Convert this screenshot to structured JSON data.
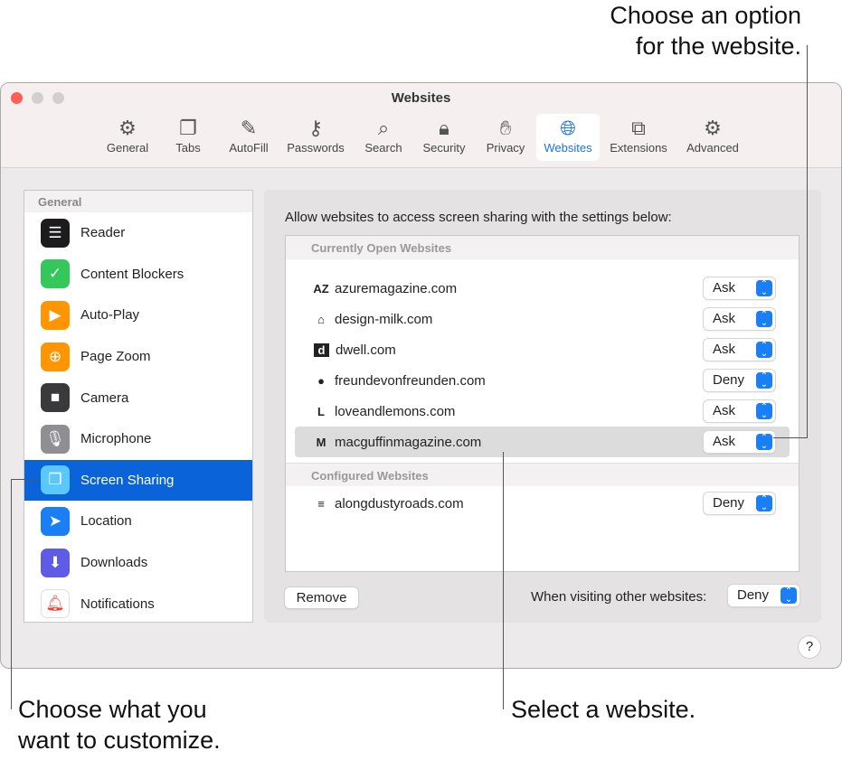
{
  "callouts": {
    "top_right": [
      "Choose an option",
      "for the website."
    ],
    "bottom_left": [
      "Choose what you",
      "want to customize."
    ],
    "bottom_mid": "Select a website."
  },
  "window": {
    "title": "Websites"
  },
  "toolbar": [
    {
      "label": "General",
      "icon": "gear-icon",
      "glyph": "⚙"
    },
    {
      "label": "Tabs",
      "icon": "tabs-icon",
      "glyph": "❐"
    },
    {
      "label": "AutoFill",
      "icon": "autofill-icon",
      "glyph": "✎"
    },
    {
      "label": "Passwords",
      "icon": "key-icon",
      "glyph": "⚷"
    },
    {
      "label": "Search",
      "icon": "search-icon",
      "glyph": "⌕"
    },
    {
      "label": "Security",
      "icon": "lock-icon",
      "glyph": "🔒︎"
    },
    {
      "label": "Privacy",
      "icon": "hand-icon",
      "glyph": "✋︎"
    },
    {
      "label": "Websites",
      "icon": "globe-icon",
      "glyph": "🌐︎",
      "active": true
    },
    {
      "label": "Extensions",
      "icon": "puzzle-icon",
      "glyph": "⧉"
    },
    {
      "label": "Advanced",
      "icon": "gears-icon",
      "glyph": "⚙"
    }
  ],
  "sidebar": {
    "header": "General",
    "items": [
      {
        "label": "Reader",
        "icon": "reader-icon",
        "glyph": "☰",
        "color": "#1c1c1e"
      },
      {
        "label": "Content Blockers",
        "icon": "shield-check-icon",
        "glyph": "✓",
        "color": "#34c759"
      },
      {
        "label": "Auto-Play",
        "icon": "play-icon",
        "glyph": "▶",
        "color": "#ff9500"
      },
      {
        "label": "Page Zoom",
        "icon": "zoom-icon",
        "glyph": "⊕",
        "color": "#ff9500"
      },
      {
        "label": "Camera",
        "icon": "camera-icon",
        "glyph": "■",
        "color": "#3a3a3c"
      },
      {
        "label": "Microphone",
        "icon": "microphone-icon",
        "glyph": "🎙︎",
        "color": "#8e8e93"
      },
      {
        "label": "Screen Sharing",
        "icon": "screen-sharing-icon",
        "glyph": "❐",
        "color": "#5ac8fa",
        "selected": true
      },
      {
        "label": "Location",
        "icon": "location-icon",
        "glyph": "➤",
        "color": "#1a7ff5"
      },
      {
        "label": "Downloads",
        "icon": "download-icon",
        "glyph": "⬇",
        "color": "#5e5ce6"
      },
      {
        "label": "Notifications",
        "icon": "bell-icon",
        "glyph": "🔔︎",
        "color": "#ff3b30"
      }
    ]
  },
  "main": {
    "intro": "Allow websites to access screen sharing with the settings below:",
    "open_header": "Currently Open Websites",
    "open_sites": [
      {
        "name": "azuremagazine.com",
        "favicon": "AZ",
        "value": "Ask"
      },
      {
        "name": "design-milk.com",
        "favicon": "⌂",
        "value": "Ask"
      },
      {
        "name": "dwell.com",
        "favicon": "d",
        "value": "Ask"
      },
      {
        "name": "freundevonfreunden.com",
        "favicon": "●",
        "value": "Deny"
      },
      {
        "name": "loveandlemons.com",
        "favicon": "L",
        "value": "Ask"
      },
      {
        "name": "macguffinmagazine.com",
        "favicon": "M",
        "value": "Ask",
        "selected": true
      }
    ],
    "configured_header": "Configured Websites",
    "configured_sites": [
      {
        "name": "alongdustyroads.com",
        "favicon": "≡",
        "value": "Deny"
      }
    ],
    "remove_label": "Remove",
    "other_label": "When visiting other websites:",
    "other_value": "Deny",
    "help": "?"
  }
}
